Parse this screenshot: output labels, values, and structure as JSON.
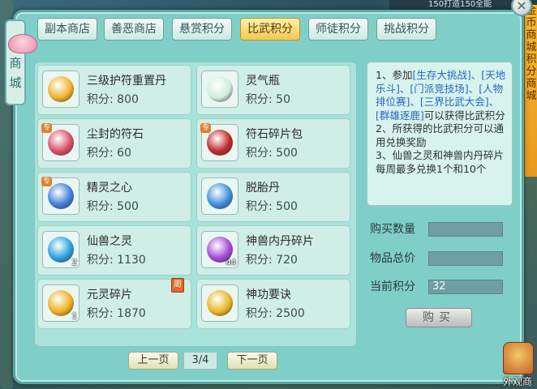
{
  "top_banner": "150打造150全能",
  "side_tab": {
    "label_1": "商",
    "label_2": "城"
  },
  "close_label": "×",
  "tabs": [
    {
      "label": "副本商店",
      "active": false
    },
    {
      "label": "善恶商店",
      "active": false
    },
    {
      "label": "悬赏积分",
      "active": false
    },
    {
      "label": "比武积分",
      "active": true
    },
    {
      "label": "师徒积分",
      "active": false
    },
    {
      "label": "挑战积分",
      "active": false
    }
  ],
  "price_prefix": "积分:",
  "items": [
    {
      "name": "三级护符重置丹",
      "price": "800",
      "icon": "golden-amulet-icon",
      "color": "#f0b32c",
      "tag": "",
      "qty": ""
    },
    {
      "name": "灵气瓶",
      "price": "50",
      "icon": "spirit-bottle-icon",
      "color": "#cfeee0",
      "tag": "",
      "qty": ""
    },
    {
      "name": "尘封的符石",
      "price": "60",
      "icon": "sealed-runestone-icon",
      "color": "#d8506a",
      "tag": "专",
      "qty": ""
    },
    {
      "name": "符石碎片包",
      "price": "500",
      "icon": "runestone-shard-bag-icon",
      "color": "#c02a2a",
      "tag": "专",
      "qty": ""
    },
    {
      "name": "精灵之心",
      "price": "500",
      "icon": "elf-heart-icon",
      "color": "#3f7fd8",
      "tag": "专",
      "qty": ""
    },
    {
      "name": "脱胎丹",
      "price": "500",
      "icon": "rebirth-pill-icon",
      "color": "#3a8fd8",
      "tag": "",
      "qty": ""
    },
    {
      "name": "仙兽之灵",
      "price": "1130",
      "icon": "immortal-beast-spirit-icon",
      "color": "#2a9fe0",
      "tag": "",
      "qty": "2"
    },
    {
      "name": "神兽内丹碎片",
      "price": "720",
      "icon": "divine-beast-core-shard-icon",
      "color": "#a24ad8",
      "tag": "",
      "qty": "44"
    },
    {
      "name": "元灵碎片",
      "price": "1870",
      "icon": "yuanling-shard-icon",
      "color": "#f0b020",
      "tag": "",
      "qty": "1",
      "week_badge": "周"
    },
    {
      "name": "神功要诀",
      "price": "2500",
      "icon": "divine-skill-manual-icon",
      "color": "#e8b820",
      "tag": "",
      "qty": ""
    }
  ],
  "description": {
    "l1a": "1、参加",
    "l1b": "[生存大挑战]",
    "l1c": "、",
    "l1d": "[天地乐斗]",
    "l1e": "、",
    "l1f": "[门派竞技场]",
    "l1g": "、",
    "l1h": "[人物排位赛]",
    "l1i": "、",
    "l1j": "[三界比武大会]",
    "l1k": "、",
    "l1l": "[群雄逐鹿]",
    "l1m": "可以获得比武积分",
    "l2": "2、所获得的比武积分可以通用兑换奖励",
    "l3": "3、仙兽之灵和神兽内丹碎片每周最多兑换1个和10个"
  },
  "form": {
    "qty_label": "购买数量",
    "qty_value": "",
    "total_label": "物品总价",
    "total_value": "",
    "points_label": "当前积分",
    "points_value": "32"
  },
  "buy_label": "购买",
  "pagination": {
    "prev": "上一页",
    "page": "3/4",
    "next": "下一页"
  },
  "right_banner": "金币商城 积分商城",
  "appearance_label": "外观商"
}
